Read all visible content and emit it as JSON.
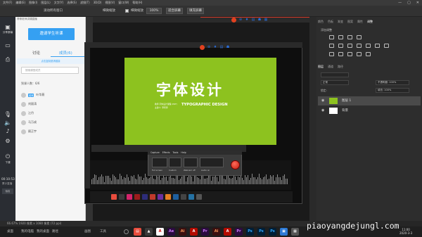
{
  "photoshop": {
    "menu": [
      "文件(F)",
      "编辑(E)",
      "图像(I)",
      "图层(L)",
      "文字(Y)",
      "选择(S)",
      "滤镜(T)",
      "3D(D)",
      "视图(V)",
      "窗口(W)",
      "帮助(H)"
    ],
    "window_controls": [
      "—",
      "▢",
      "✕"
    ],
    "options": {
      "scroll_all": "滚动所有窗口",
      "zoom_100": "100%",
      "fit_screen": "适合屏幕",
      "fill_screen": "填充屏幕",
      "fine_zoom": "细微缩放"
    },
    "status": "66.67%    1920 像素 x 1080 像素 (72 ppi)",
    "panel_tabs_top": [
      "颜色",
      "色板",
      "渐变",
      "图案",
      "属性",
      "调整"
    ],
    "adjust_label": "添加调整",
    "panel_tabs_layers": [
      "图层",
      "通道",
      "路径"
    ],
    "blend_mode": "正常",
    "opacity": "不透明度: 100%",
    "lock_label": "锁定:",
    "fill": "填充: 100%",
    "layers": [
      {
        "name": "图层 1",
        "selected": true
      },
      {
        "name": "背景",
        "selected": false
      }
    ]
  },
  "artwork": {
    "title_cn": "字体设计",
    "title_en": "TYPOGRAPHIC DESIGN",
    "small1": "教师 字体设计课程 (PDF)",
    "small2": "主讲人: 李老师"
  },
  "recorder": {
    "menu": [
      "Capture",
      "Effects",
      "Tools",
      "Help"
    ],
    "labels": [
      "Full screen",
      "Custom",
      "Webcam off",
      "Audio on"
    ]
  },
  "live": {
    "left_buttons": [
      {
        "icon": "▣",
        "label": "分享屏幕"
      },
      {
        "icon": "▭",
        "label": ""
      },
      {
        "icon": "⎙",
        "label": ""
      },
      {
        "icon": "◉",
        "label": ""
      },
      {
        "icon": "⚙",
        "label": ""
      },
      {
        "icon": "⏻",
        "label": "下课"
      }
    ],
    "timer": "00:10:53",
    "timer_sub": "累计直播",
    "quality": "标清",
    "panel_title": "哆唻老师讲课直播",
    "invite_btn": "邀请学生听课",
    "tabs": [
      "讨论",
      "成员(6)"
    ],
    "notice": "点击复制邀请链接",
    "search_placeholder": "搜索课堂成员",
    "arrived": "到课人数：6/6",
    "members": [
      {
        "name": "叶华燕",
        "tag": "老师"
      },
      {
        "name": "刘丽涛",
        "tag": ""
      },
      {
        "name": "江丹",
        "tag": ""
      },
      {
        "name": "马万成",
        "tag": ""
      },
      {
        "name": "顾正宇",
        "tag": ""
      }
    ]
  },
  "taskbar": {
    "items": [
      "桌面",
      "我的电脑",
      "我的桌面",
      "路径",
      "画图",
      "工具"
    ],
    "clock_time": "11:00",
    "clock_date": "2020-3-3",
    "watermark": "piaoyangdejungl.com"
  },
  "colors": {
    "green": "#8dc21f",
    "accent_blue": "#35a0f2",
    "record_red": "#c41e10"
  }
}
